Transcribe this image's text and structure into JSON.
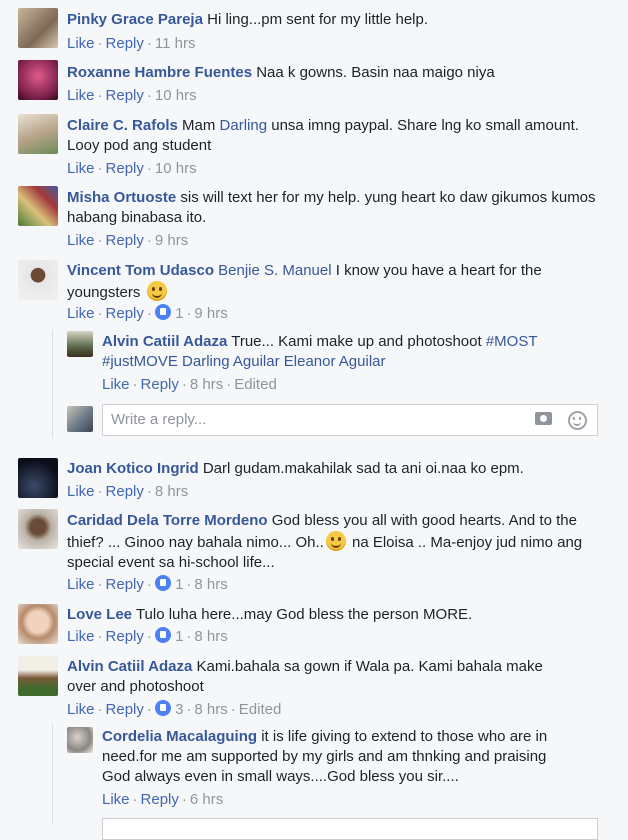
{
  "actions": {
    "like": "Like",
    "reply": "Reply",
    "edited": "Edited"
  },
  "comments": [
    {
      "author": "Pinky Grace Pareja",
      "text": "Hi ling...pm sent for my little help.",
      "time": "11 hrs"
    },
    {
      "author": "Roxanne Hambre Fuentes",
      "text": "Naa k gowns. Basin naa maigo niya",
      "time": "10 hrs"
    },
    {
      "author": "Claire C. Rafols",
      "text_pre": "Mam ",
      "tag": "Darling",
      "text": " unsa imng paypal. Share lng ko small amount. Looy pod ang student",
      "time": "10 hrs"
    },
    {
      "author": "Misha Ortuoste",
      "text": "sis will text her for my help. yung heart ko daw gikumos kumos habang binabasa ito.",
      "time": "9 hrs"
    },
    {
      "author": "Vincent Tom Udasco",
      "tag": "Benjie S. Manuel",
      "text": " I know you have a heart for the youngsters",
      "reactions": "1",
      "time": "9 hrs"
    },
    {
      "author": "Joan Kotico Ingrid",
      "text": "Darl gudam.makahilak sad ta ani oi.naa ko epm.",
      "time": "8 hrs"
    },
    {
      "author": "Caridad Dela Torre Mordeno",
      "text": "God bless you all with good hearts. And to the thief? ... Ginoo nay bahala nimo... Oh..",
      "text2": " na Eloisa .. Ma-enjoy jud nimo ang special event sa hi-school life...",
      "reactions": "1",
      "time": "8 hrs"
    },
    {
      "author": "Love Lee",
      "text": "Tulo luha here...may God bless the person MORE.",
      "reactions": "1",
      "time": "8 hrs"
    },
    {
      "author": "Alvin Catiil Adaza",
      "text": "Kami.bahala sa gown if Wala pa. Kami bahala make over and photoshoot",
      "reactions": "3",
      "time": "8 hrs"
    }
  ],
  "replies": [
    {
      "author": "Alvin Catiil Adaza",
      "text": "True... Kami make up and photoshoot ",
      "hashtag1": "#MOST",
      "hashtag2": "#justMOVE",
      "tag1": "Darling Aguilar",
      "tag2": "Eleanor Aguilar",
      "time": "8 hrs"
    },
    {
      "author": "Cordelia Macalaguing",
      "text": "it is life giving to extend to those who are in need.for me am supported by my girls and am thnking and praising God always even in small ways....God bless you sir....",
      "time": "6 hrs"
    }
  ],
  "reply_box": {
    "placeholder": "Write a reply...",
    "camera_icon": "camera-icon",
    "emoji_icon": "emoji-icon"
  },
  "colors": {
    "link": "#365899",
    "meta": "#90949c",
    "background": "#f6f7f9"
  }
}
